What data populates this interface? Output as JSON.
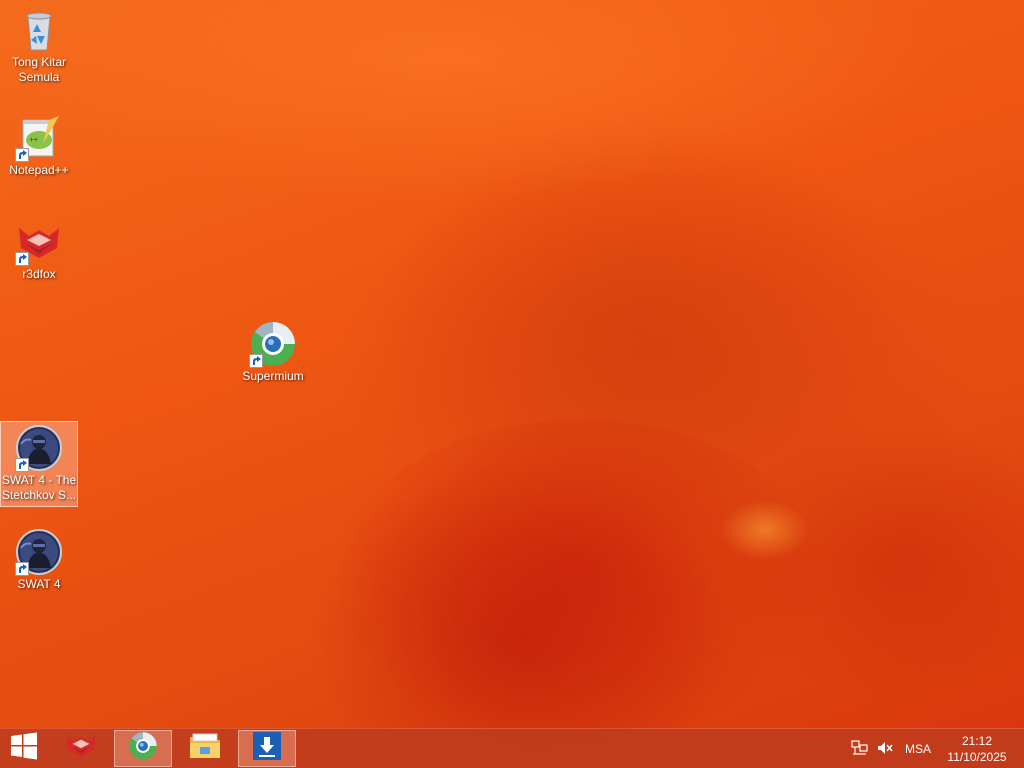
{
  "desktop": {
    "icons": [
      {
        "label": "Tong Kitar Semula",
        "icon": "recycle-bin-icon"
      },
      {
        "label": "Notepad++",
        "icon": "notepad-plus-plus-icon"
      },
      {
        "label": "r3dfox",
        "icon": "r3dfox-icon"
      },
      {
        "label": "Supermium",
        "icon": "supermium-icon"
      },
      {
        "label": "SWAT 4 - The Stetchkov S...",
        "icon": "swat4-icon"
      },
      {
        "label": "SWAT 4",
        "icon": "swat4-icon"
      }
    ]
  },
  "taskbar": {
    "start": {
      "icon": "windows-logo-icon"
    },
    "pinned": [
      {
        "icon": "r3dfox-icon"
      },
      {
        "icon": "supermium-icon",
        "active": true
      },
      {
        "icon": "file-explorer-icon"
      },
      {
        "icon": "download-icon"
      }
    ],
    "tray": {
      "network_icon": "network-icon",
      "volume_icon": "volume-muted-icon",
      "language": "MSA"
    },
    "clock": {
      "time": "21:12",
      "date": "11/10/2025"
    }
  },
  "colors": {
    "wallpaper": "#ee5612",
    "taskbar": "#be3c1e",
    "accent_blue": "#1d5fb5"
  }
}
